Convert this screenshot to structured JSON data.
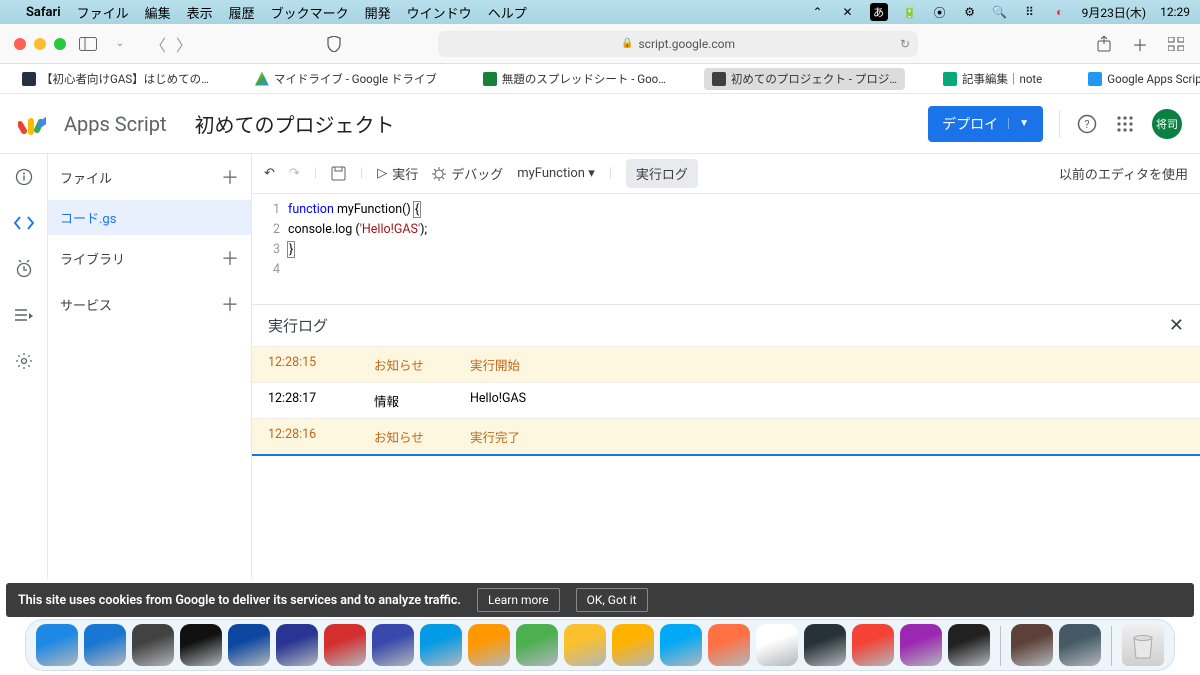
{
  "menubar": {
    "app": "Safari",
    "items": [
      "ファイル",
      "編集",
      "表示",
      "履歴",
      "ブックマーク",
      "開発",
      "ウインドウ",
      "ヘルプ"
    ],
    "date": "9月23日(木)",
    "time": "12:29",
    "input_source": "あ"
  },
  "safari": {
    "url_host": "script.google.com",
    "favorites": [
      {
        "label": "【初心者向けGAS】はじめての…",
        "icon": "#273041",
        "active": false
      },
      {
        "label": "マイドライブ - Google ドライブ",
        "icon": "#f3b600",
        "active": false,
        "tri": true
      },
      {
        "label": "無題のスプレッドシート - Goo…",
        "icon": "#188038",
        "active": false
      },
      {
        "label": "初めてのプロジェクト - プロジ…",
        "icon": "#3c4043",
        "active": true
      },
      {
        "label": "記事編集｜note",
        "icon": "#09a878",
        "active": false
      },
      {
        "label": "Google Apps Script入門～ス…",
        "icon": "#2196f3",
        "active": false
      }
    ]
  },
  "app": {
    "brand": "Apps Script",
    "project_name": "初めてのプロジェクト",
    "deploy_label": "デプロイ",
    "avatar_text": "将司",
    "legacy_label": "以前のエディタを使用"
  },
  "sidebar": {
    "sections": [
      {
        "label": "ファイル"
      },
      {
        "label": "ライブラリ"
      },
      {
        "label": "サービス"
      }
    ],
    "active_file": "コード.gs"
  },
  "editor_toolbar": {
    "run_label": "実行",
    "debug_label": "デバッグ",
    "function_name": "myFunction",
    "log_label": "実行ログ"
  },
  "code": {
    "lines": [
      {
        "n": 1,
        "tokens": [
          {
            "t": "function ",
            "c": "kw1"
          },
          {
            "t": "myFunction() ",
            "c": "fnname"
          },
          {
            "t": "{",
            "c": "cursor-box"
          }
        ]
      },
      {
        "n": 2,
        "tokens": [
          {
            "t": "  console.log (",
            "c": "punc"
          },
          {
            "t": "'Hello!GAS'",
            "c": "str"
          },
          {
            "t": ");",
            "c": "punc"
          }
        ]
      },
      {
        "n": 3,
        "tokens": [
          {
            "t": "}",
            "c": "cursor-box"
          }
        ]
      },
      {
        "n": 4,
        "tokens": []
      }
    ]
  },
  "log": {
    "title": "実行ログ",
    "rows": [
      {
        "time": "12:28:15",
        "level": "お知らせ",
        "msg": "実行開始",
        "notice": true
      },
      {
        "time": "12:28:17",
        "level": "情報",
        "msg": "Hello!GAS",
        "notice": false
      },
      {
        "time": "12:28:16",
        "level": "お知らせ",
        "msg": "実行完了",
        "notice": true
      }
    ]
  },
  "cookie": {
    "text": "This site uses cookies from Google to deliver its services and to analyze traffic.",
    "learn": "Learn more",
    "ok": "OK, Got it"
  },
  "dock": {
    "icons": [
      "#1e88e5",
      "#1976d2",
      "#424242",
      "#111",
      "#0d47a1",
      "#283593",
      "#d32f2f",
      "#3949ab",
      "#039be5",
      "#ff9800",
      "#4caf50",
      "#fbc02d",
      "#ffb300",
      "#03a9f4",
      "#ff7043",
      "#ffffff",
      "#263238",
      "#f44336",
      "#9c27b0",
      "#212121"
    ],
    "right_icons": [
      "#5d4037",
      "#455a64"
    ]
  }
}
